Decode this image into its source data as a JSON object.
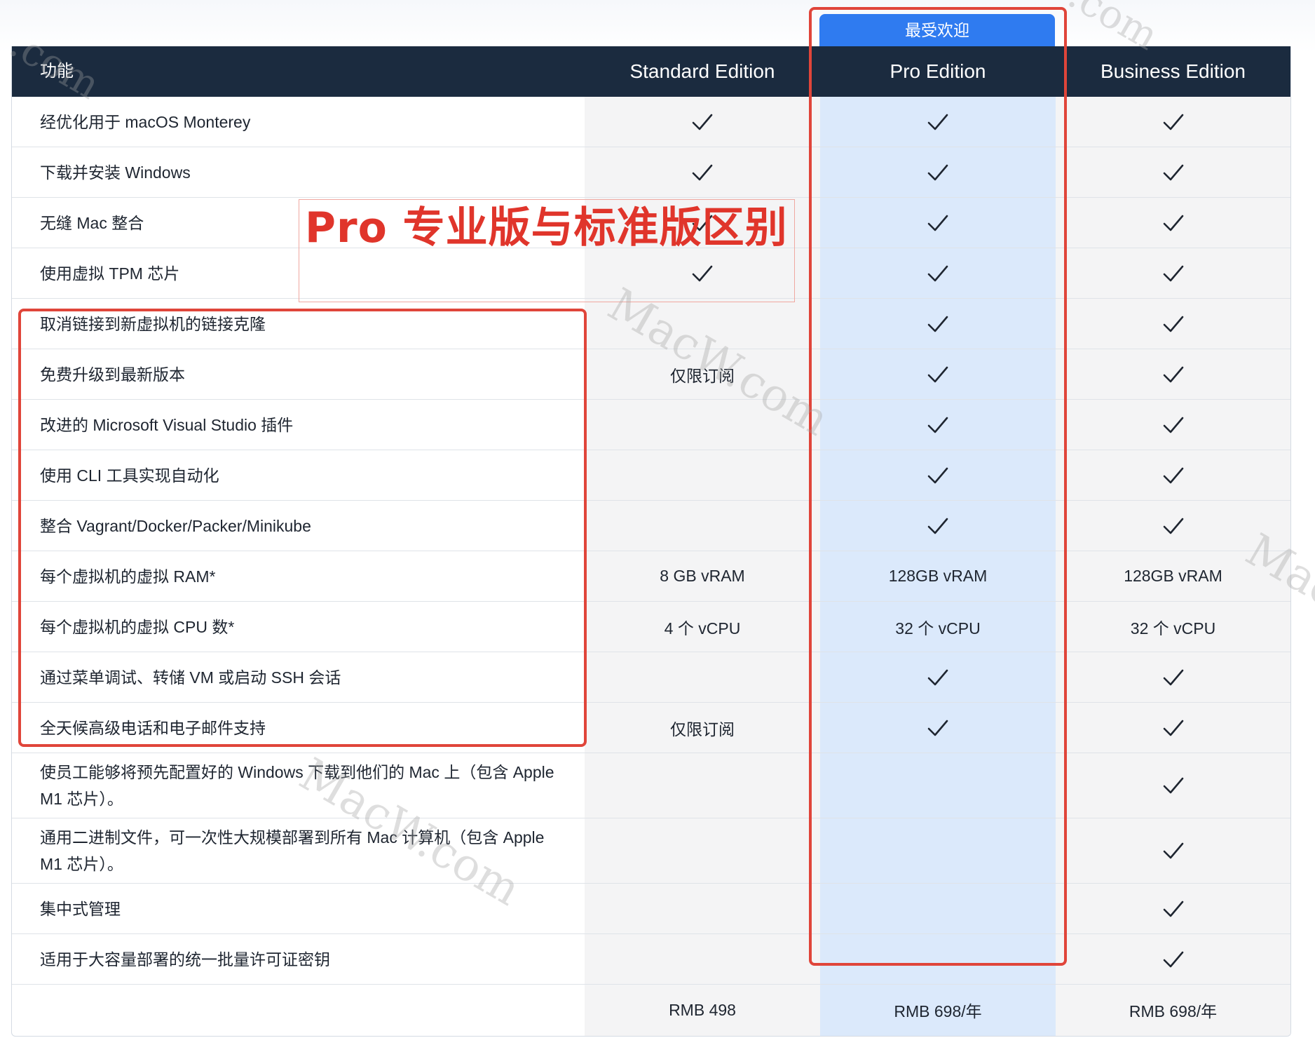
{
  "badge": {
    "label": "最受欢迎"
  },
  "header": {
    "feature": "功能",
    "standard": "Standard Edition",
    "pro": "Pro Edition",
    "business": "Business Edition"
  },
  "rows": [
    {
      "feature": "经优化用于 macOS Monterey",
      "std": "check",
      "pro": "check",
      "biz": "check"
    },
    {
      "feature": "下载并安装 Windows",
      "std": "check",
      "pro": "check",
      "biz": "check"
    },
    {
      "feature": "无缝 Mac 整合",
      "std": "check",
      "pro": "check",
      "biz": "check"
    },
    {
      "feature": "使用虚拟 TPM 芯片",
      "std": "check",
      "pro": "check",
      "biz": "check"
    },
    {
      "feature": "取消链接到新虚拟机的链接克隆",
      "std": "",
      "pro": "check",
      "biz": "check"
    },
    {
      "feature": "免费升级到最新版本",
      "std": "仅限订阅",
      "pro": "check",
      "biz": "check"
    },
    {
      "feature": "改进的 Microsoft Visual Studio 插件",
      "std": "",
      "pro": "check",
      "biz": "check"
    },
    {
      "feature": "使用 CLI 工具实现自动化",
      "std": "",
      "pro": "check",
      "biz": "check"
    },
    {
      "feature": "整合 Vagrant/Docker/Packer/Minikube",
      "std": "",
      "pro": "check",
      "biz": "check"
    },
    {
      "feature": "每个虚拟机的虚拟 RAM*",
      "std": "8 GB vRAM",
      "pro": "128GB vRAM",
      "biz": "128GB vRAM"
    },
    {
      "feature": "每个虚拟机的虚拟 CPU 数*",
      "std": "4 个 vCPU",
      "pro": "32 个 vCPU",
      "biz": "32 个 vCPU"
    },
    {
      "feature": "通过菜单调试、转储 VM 或启动 SSH 会话",
      "std": "",
      "pro": "check",
      "biz": "check"
    },
    {
      "feature": "全天候高级电话和电子邮件支持",
      "std": "仅限订阅",
      "pro": "check",
      "biz": "check"
    },
    {
      "feature": "使员工能够将预先配置好的 Windows 下载到他们的 Mac 上（包含 Apple M1 芯片）。",
      "std": "",
      "pro": "",
      "biz": "check"
    },
    {
      "feature": "通用二进制文件，可一次性大规模部署到所有 Mac 计算机（包含 Apple M1 芯片）。",
      "std": "",
      "pro": "",
      "biz": "check"
    },
    {
      "feature": "集中式管理",
      "std": "",
      "pro": "",
      "biz": "check"
    },
    {
      "feature": "适用于大容量部署的统一批量许可证密钥",
      "std": "",
      "pro": "",
      "biz": "check"
    }
  ],
  "price": {
    "feature": "",
    "std": "RMB 498",
    "pro": "RMB 698/年",
    "biz": "RMB 698/年"
  },
  "annotation": {
    "text": "Pro 专业版与标准版区别"
  },
  "watermark": {
    "text": "MacW.com",
    "short": ".com"
  },
  "colors": {
    "header_bg": "#1b2b3f",
    "badge_bg": "#2f7bf0",
    "pro_column_bg": "#dbe9fb",
    "annotation_red": "#e0453a"
  }
}
